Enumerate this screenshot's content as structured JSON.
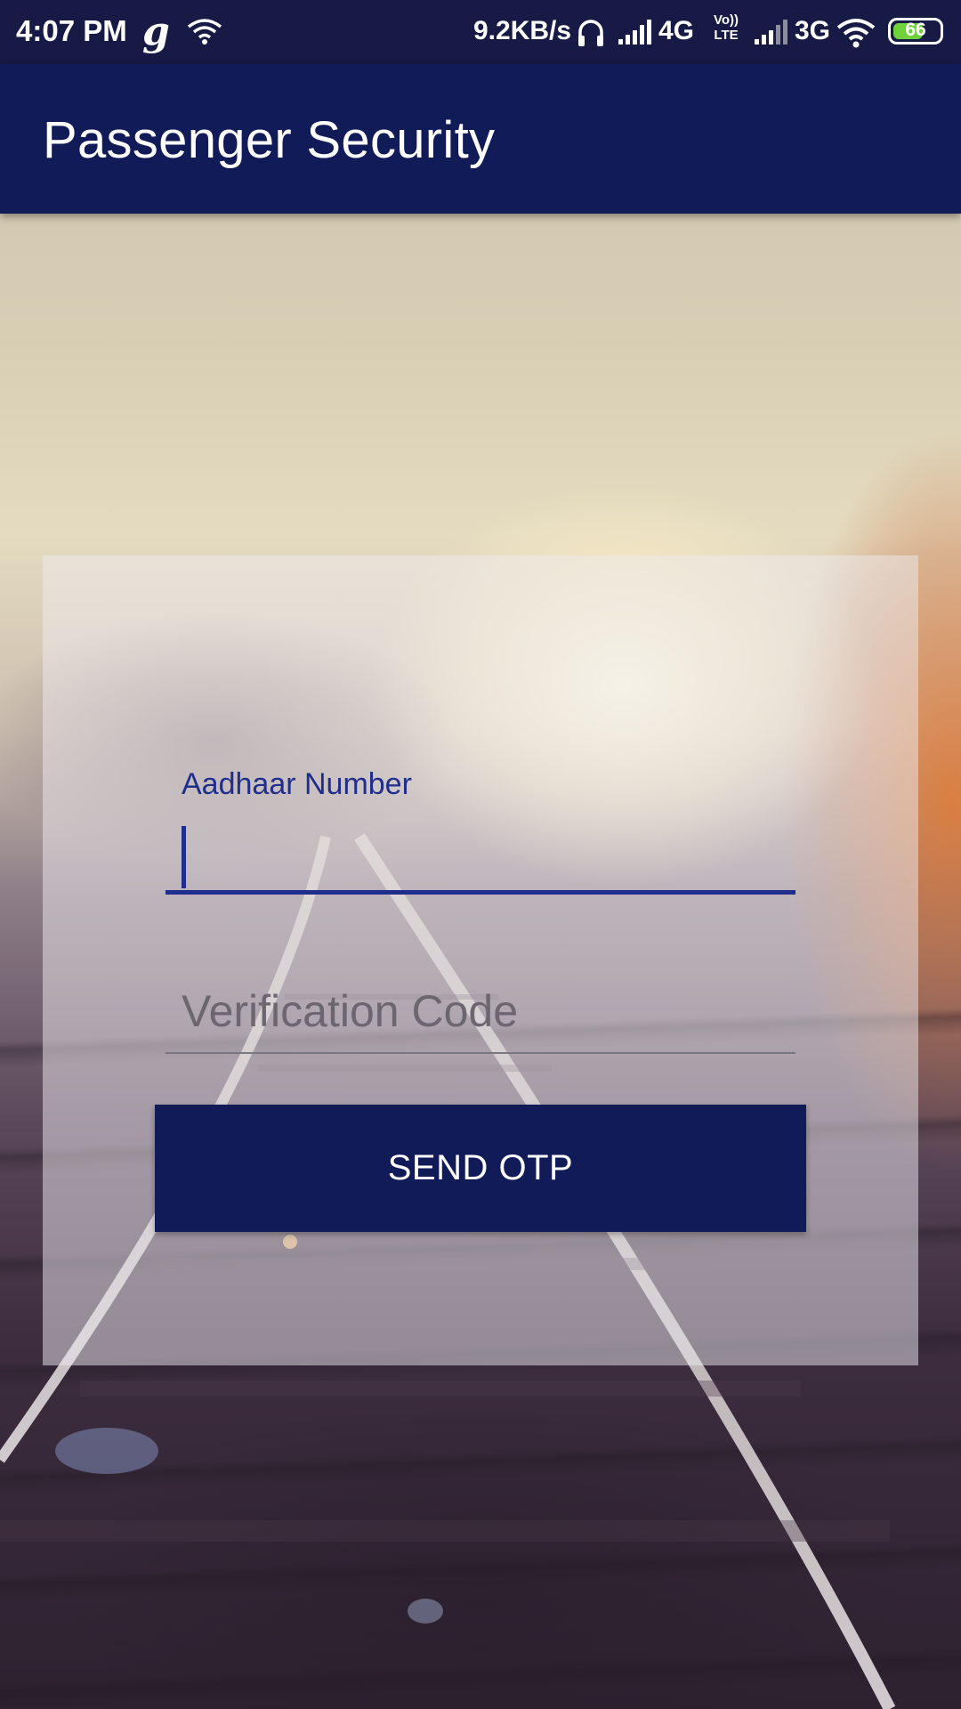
{
  "status_bar": {
    "time": "4:07 PM",
    "app_glyph": "g",
    "network_speed": "9.2KB/s",
    "sim1_type": "4G",
    "volte_top": "Vo))",
    "volte_bottom": "LTE",
    "sim2_type": "3G",
    "battery_level": "66",
    "battery_fraction": 0.66,
    "icons": [
      "wifi-icon",
      "headphones-icon",
      "signal-icon",
      "signal-icon",
      "wifi-icon",
      "battery-icon"
    ]
  },
  "app_bar": {
    "title": "Passenger Security"
  },
  "form": {
    "aadhaar": {
      "label": "Aadhaar Number",
      "value": ""
    },
    "verification": {
      "placeholder": "Verification Code",
      "value": ""
    },
    "send_button_label": "SEND OTP"
  },
  "colors": {
    "status_bar": "#161a44",
    "app_bar": "#111b57",
    "accent": "#1f2d8c",
    "battery_fill": "#6fd23a"
  }
}
